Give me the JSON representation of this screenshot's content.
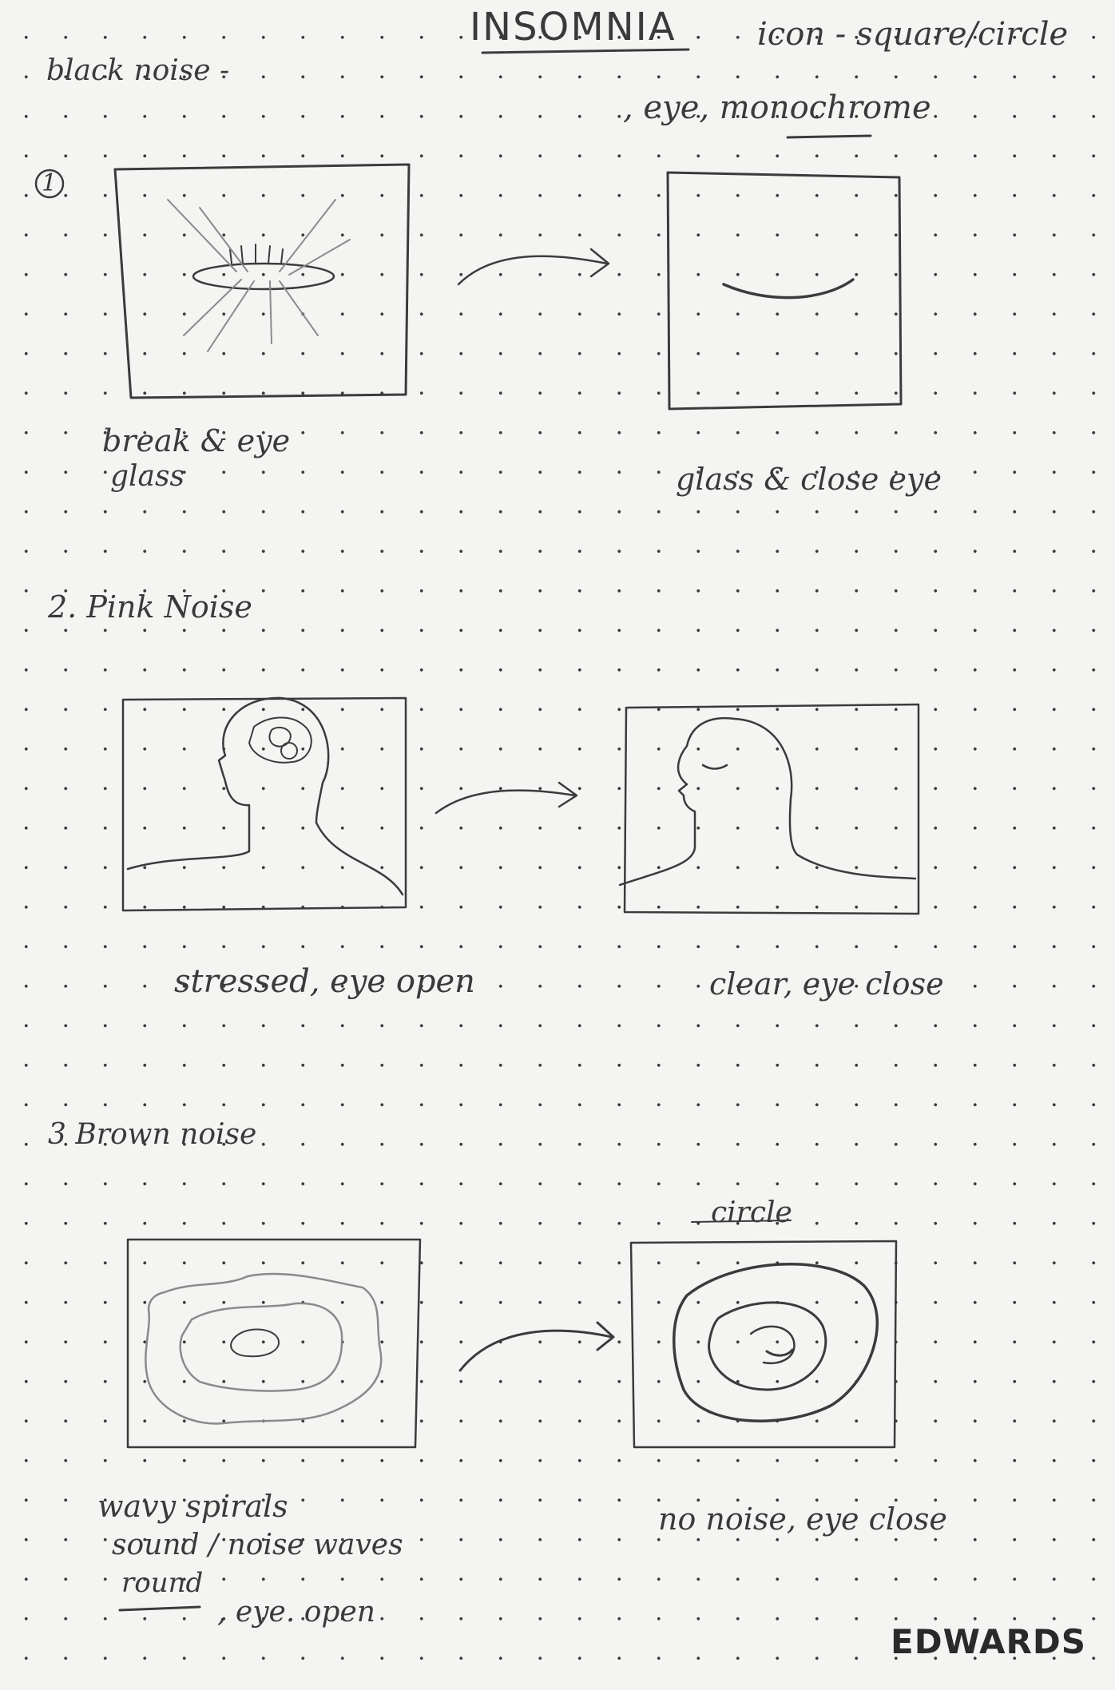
{
  "header": {
    "title": "INSOMNIA",
    "note_icon": "icon - square/circle",
    "note_style": ", eye, monochrome",
    "section_label": "black noise -"
  },
  "section1": {
    "number": "1",
    "left_caption_line1": "break & eye",
    "left_caption_line2": "glass",
    "right_caption": "glass & close eye"
  },
  "section2": {
    "heading": "2. Pink Noise",
    "left_caption": "stressed, eye open",
    "right_caption": "clear, eye close"
  },
  "section3": {
    "heading": "3 Brown noise",
    "right_top_label": "circle",
    "left_caption_line1": "wavy spirals",
    "left_caption_line2": "sound / noise waves",
    "left_caption_line3": "round",
    "left_caption_line4": ", eye. open",
    "right_caption": "no noise, eye close"
  },
  "logo": {
    "text": "EDWARDS"
  }
}
